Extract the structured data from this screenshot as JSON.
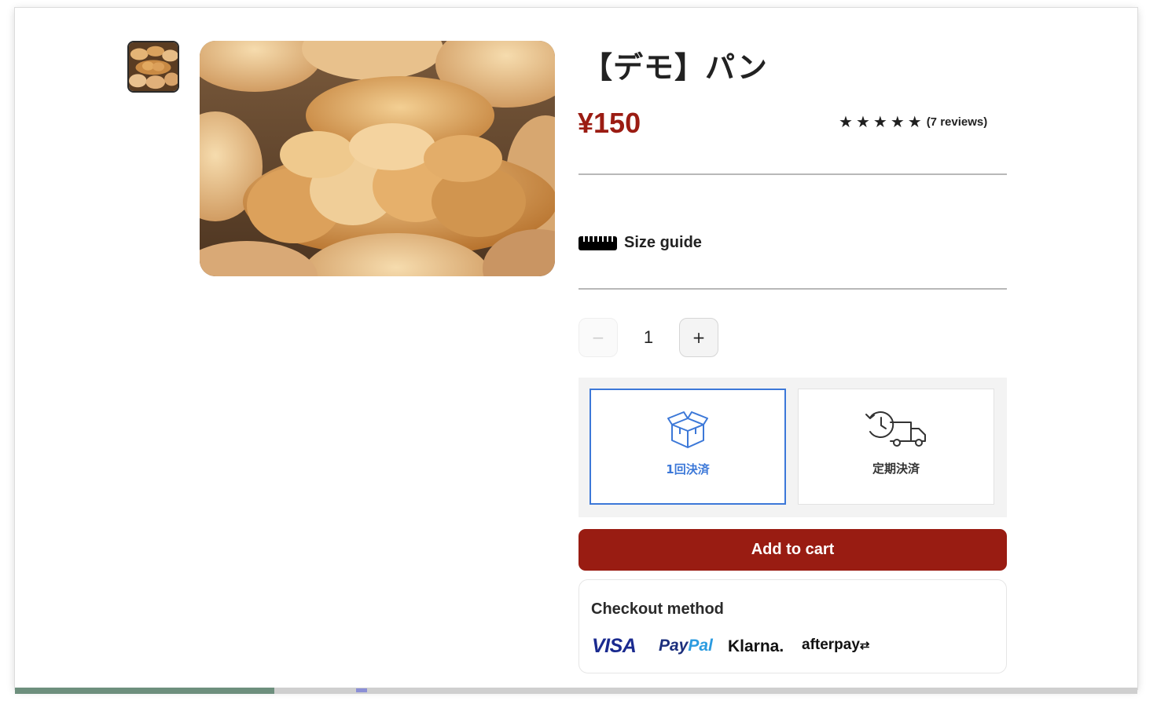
{
  "product": {
    "title": "【デモ】パン",
    "price": "¥150",
    "rating": {
      "stars": 5,
      "reviews_label": "(7 reviews)"
    },
    "image": {
      "thumb_label": "bread-thumbnail",
      "main_label": "bread-photo"
    }
  },
  "size_guide": {
    "label": "Size guide",
    "icon": "ruler-icon"
  },
  "quantity": {
    "value": "1",
    "minus_symbol": "−",
    "plus_symbol": "+"
  },
  "purchase_options": [
    {
      "label": "1回決済",
      "icon": "box-icon",
      "selected": true
    },
    {
      "label": "定期決済",
      "icon": "subscription-truck-icon",
      "selected": false
    }
  ],
  "cart": {
    "button_label": "Add to cart"
  },
  "checkout": {
    "title": "Checkout method",
    "methods": [
      "VISA",
      "PayPal",
      "Klarna.",
      "afterpay"
    ]
  },
  "colors": {
    "price": "#9b1c13",
    "add_to_cart_bg": "#991c12",
    "selected_option": "#3c78d8"
  }
}
